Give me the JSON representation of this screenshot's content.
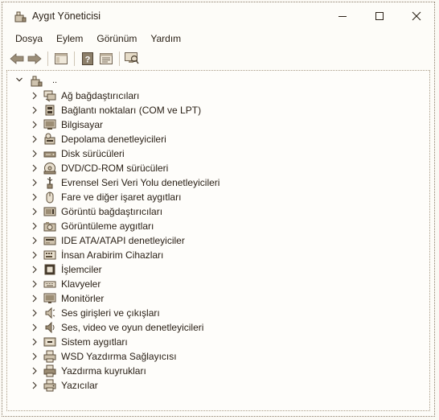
{
  "window": {
    "title": "Aygıt Yöneticisi"
  },
  "menu": [
    "Dosya",
    "Eylem",
    "Görünüm",
    "Yardım"
  ],
  "tree": {
    "root_label": "..",
    "categories": [
      {
        "label": "Ağ bağdaştırıcıları",
        "icon": "network-adapter-icon"
      },
      {
        "label": "Bağlantı noktaları (COM ve LPT)",
        "icon": "port-icon"
      },
      {
        "label": "Bilgisayar",
        "icon": "computer-icon"
      },
      {
        "label": "Depolama denetleyicileri",
        "icon": "storage-controller-icon"
      },
      {
        "label": "Disk sürücüleri",
        "icon": "disk-drive-icon"
      },
      {
        "label": "DVD/CD-ROM sürücüleri",
        "icon": "dvd-icon"
      },
      {
        "label": "Evrensel Seri Veri Yolu denetleyicileri",
        "icon": "usb-icon"
      },
      {
        "label": "Fare ve diğer işaret aygıtları",
        "icon": "mouse-icon"
      },
      {
        "label": "Görüntü bağdaştırıcıları",
        "icon": "display-adapter-icon"
      },
      {
        "label": "Görüntüleme aygıtları",
        "icon": "imaging-device-icon"
      },
      {
        "label": "IDE ATA/ATAPI denetleyiciler",
        "icon": "ide-controller-icon"
      },
      {
        "label": "İnsan Arabirim Cihazları",
        "icon": "hid-icon"
      },
      {
        "label": "İşlemciler",
        "icon": "processor-icon"
      },
      {
        "label": "Klavyeler",
        "icon": "keyboard-icon"
      },
      {
        "label": "Monitörler",
        "icon": "monitor-icon"
      },
      {
        "label": "Ses girişleri ve çıkışları",
        "icon": "audio-io-icon"
      },
      {
        "label": "Ses, video ve oyun denetleyicileri",
        "icon": "sound-controller-icon"
      },
      {
        "label": "Sistem aygıtları",
        "icon": "system-device-icon"
      },
      {
        "label": "WSD Yazdırma Sağlayıcısı",
        "icon": "wsd-printer-icon"
      },
      {
        "label": "Yazdırma kuyrukları",
        "icon": "print-queue-icon"
      },
      {
        "label": "Yazıcılar",
        "icon": "printer-icon"
      }
    ]
  }
}
